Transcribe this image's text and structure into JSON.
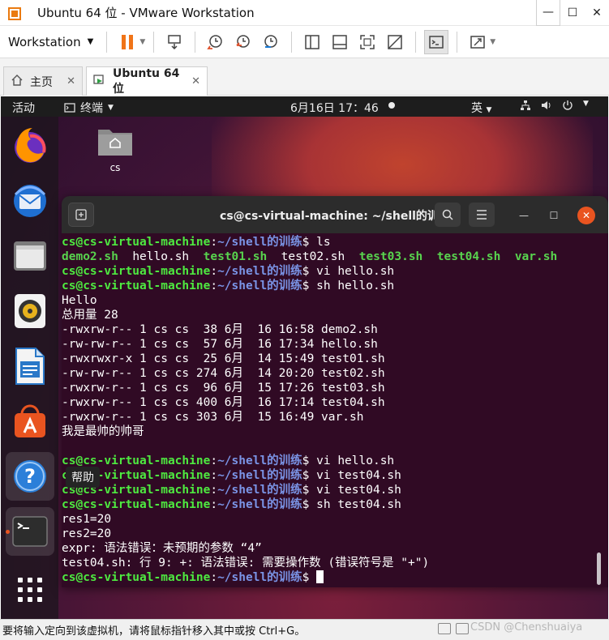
{
  "window": {
    "title": "Ubuntu 64 位 - VMware Workstation"
  },
  "toolbar": {
    "workstation_label": "Workstation"
  },
  "tabs": [
    {
      "label": "主页",
      "icon": "home-icon"
    },
    {
      "label": "Ubuntu 64 位",
      "icon": "vm-icon"
    }
  ],
  "ubuntu": {
    "activities": "活动",
    "app_menu": "终端",
    "clock": "6月16日  17：46",
    "input_method": "英",
    "desktop_folder": "cs",
    "tooltip": "帮助"
  },
  "terminal": {
    "title": "cs@cs-virtual-machine: ~/shell的训练",
    "prompt_user": "cs@cs-virtual-machine",
    "prompt_path": "~/shell的训练",
    "lines": [
      {
        "type": "prompt",
        "cmd": " ls"
      },
      {
        "type": "ls",
        "items": [
          "demo2.sh",
          "hello.sh",
          "test01.sh",
          "test02.sh",
          "test03.sh",
          "test04.sh",
          "var.sh"
        ]
      },
      {
        "type": "prompt",
        "cmd": " vi hello.sh"
      },
      {
        "type": "prompt",
        "cmd": " sh hello.sh"
      },
      {
        "type": "out",
        "text": "Hello"
      },
      {
        "type": "out",
        "text": "总用量 28"
      },
      {
        "type": "out",
        "text": "-rwxrw-r-- 1 cs cs  38 6月  16 16:58 demo2.sh"
      },
      {
        "type": "out",
        "text": "-rw-rw-r-- 1 cs cs  57 6月  16 17:34 hello.sh"
      },
      {
        "type": "out",
        "text": "-rwxrwxr-x 1 cs cs  25 6月  14 15:49 test01.sh"
      },
      {
        "type": "out",
        "text": "-rw-rw-r-- 1 cs cs 274 6月  14 20:20 test02.sh"
      },
      {
        "type": "out",
        "text": "-rwxrw-r-- 1 cs cs  96 6月  15 17:26 test03.sh"
      },
      {
        "type": "out",
        "text": "-rwxrw-r-- 1 cs cs 400 6月  16 17:14 test04.sh"
      },
      {
        "type": "out",
        "text": "-rwxrw-r-- 1 cs cs 303 6月  15 16:49 var.sh"
      },
      {
        "type": "out",
        "text": "我是最帅的帅哥"
      },
      {
        "type": "out",
        "text": ""
      },
      {
        "type": "prompt",
        "cmd": " vi hello.sh"
      },
      {
        "type": "prompt",
        "cmd": " vi test04.sh"
      },
      {
        "type": "prompt",
        "cmd": " vi test04.sh"
      },
      {
        "type": "prompt",
        "cmd": " sh test04.sh"
      },
      {
        "type": "out",
        "text": "res1=20"
      },
      {
        "type": "out",
        "text": "res2=20"
      },
      {
        "type": "out",
        "text": "expr: 语法错误：未预期的参数 “4”"
      },
      {
        "type": "out",
        "text": "test04.sh: 行 9: +: 语法错误: 需要操作数 (错误符号是 \"+\")"
      },
      {
        "type": "prompt",
        "cmd": " ",
        "cursor": true
      }
    ]
  },
  "statusbar": {
    "message": "要将输入定向到该虚拟机，请将鼠标指针移入其中或按 Ctrl+G。",
    "watermark": "CSDN @Chenshuaiya"
  },
  "colors": {
    "accent": "#e95420",
    "vmware_orange": "#f07418",
    "prompt_green": "#4eea40",
    "prompt_blue": "#7a94e6"
  }
}
